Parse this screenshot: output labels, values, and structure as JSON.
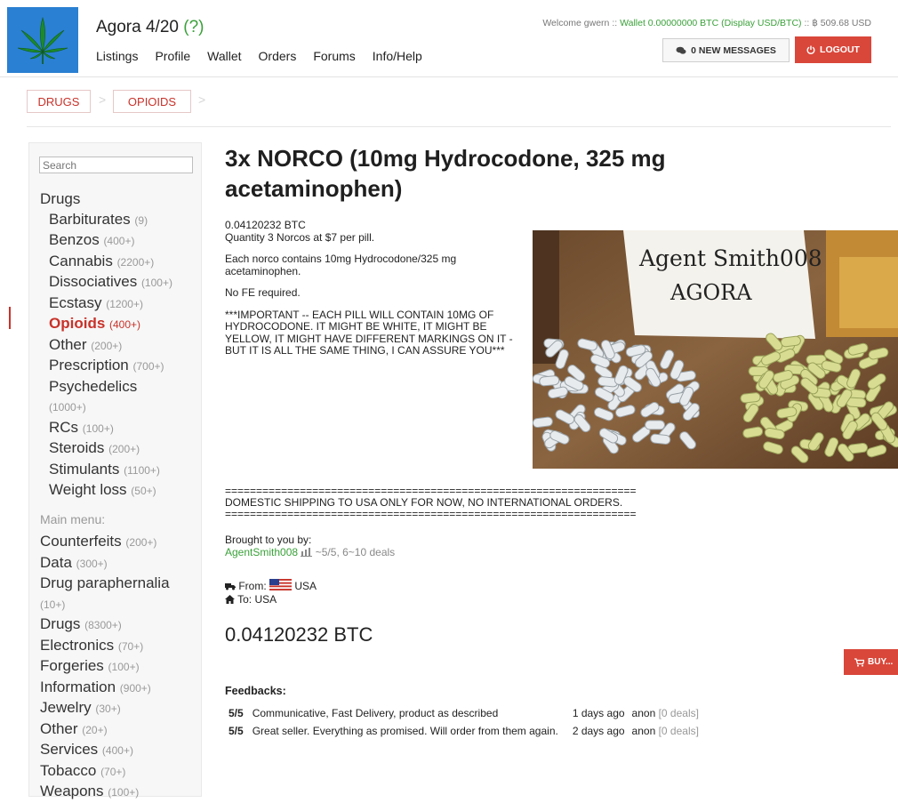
{
  "header": {
    "site_name": "Agora 4/20",
    "help_mark": "(?)",
    "nav": [
      "Listings",
      "Profile",
      "Wallet",
      "Orders",
      "Forums",
      "Info/Help"
    ],
    "welcome_prefix": "Welcome gwern :: ",
    "wallet_text": "Wallet 0.00000000 BTC",
    "display_text": "(Display USD/BTC)",
    "rate_text": " :: ฿ 509.68 USD",
    "messages_label": "0 NEW MESSAGES",
    "logout_label": "LOGOUT"
  },
  "breadcrumb": [
    "DRUGS",
    "OPIOIDS"
  ],
  "sidebar": {
    "search_placeholder": "Search",
    "section_label": "Drugs",
    "drug_items": [
      {
        "label": "Barbiturates",
        "count": "(9)"
      },
      {
        "label": "Benzos",
        "count": "(400+)"
      },
      {
        "label": "Cannabis",
        "count": "(2200+)"
      },
      {
        "label": "Dissociatives",
        "count": "(100+)"
      },
      {
        "label": "Ecstasy",
        "count": "(1200+)"
      },
      {
        "label": "Opioids",
        "count": "(400+)"
      },
      {
        "label": "Other",
        "count": "(200+)"
      },
      {
        "label": "Prescription",
        "count": "(700+)"
      },
      {
        "label": "Psychedelics",
        "count": "(1000+)"
      },
      {
        "label": "RCs",
        "count": "(100+)"
      },
      {
        "label": "Steroids",
        "count": "(200+)"
      },
      {
        "label": "Stimulants",
        "count": "(1100+)"
      },
      {
        "label": "Weight loss",
        "count": "(50+)"
      }
    ],
    "main_menu_label": "Main menu:",
    "main_items": [
      {
        "label": "Counterfeits",
        "count": "(200+)"
      },
      {
        "label": "Data",
        "count": "(300+)"
      },
      {
        "label": "Drug paraphernalia",
        "count": "(10+)"
      },
      {
        "label": "Drugs",
        "count": "(8300+)"
      },
      {
        "label": "Electronics",
        "count": "(70+)"
      },
      {
        "label": "Forgeries",
        "count": "(100+)"
      },
      {
        "label": "Information",
        "count": "(900+)"
      },
      {
        "label": "Jewelry",
        "count": "(30+)"
      },
      {
        "label": "Other",
        "count": "(20+)"
      },
      {
        "label": "Services",
        "count": "(400+)"
      },
      {
        "label": "Tobacco",
        "count": "(70+)"
      },
      {
        "label": "Weapons",
        "count": "(100+)"
      }
    ]
  },
  "listing": {
    "title": "3x NORCO (10mg Hydrocodone, 325 mg acetaminophen)",
    "price_line": "0.04120232 BTC",
    "quantity_line": "Quantity 3 Norcos at $7 per pill.",
    "desc_1": "Each norco contains 10mg Hydrocodone/325 mg acetaminophen.",
    "desc_2": "No FE required.",
    "desc_3": "***IMPORTANT -- EACH PILL WILL CONTAIN 10MG OF HYDROCODONE. IT MIGHT BE WHITE, IT MIGHT BE YELLOW, IT MIGHT HAVE DIFFERENT MARKINGS ON IT - BUT IT IS ALL THE SAME THING, I CAN ASSURE YOU***",
    "photo_note_1": "Agent Smith008",
    "photo_note_2": "AGORA",
    "separator": "==================================================================",
    "shipping_note": "DOMESTIC SHIPPING TO USA ONLY FOR NOW, NO INTERNATIONAL ORDERS.",
    "brought_label": "Brought to you by:",
    "seller": "AgentSmith008",
    "seller_stats": "~5/5, 6~10 deals",
    "from_label": "From:",
    "from_country": "USA",
    "to_label": "To: USA",
    "price": "0.04120232 BTC",
    "buy_label": "BUY..."
  },
  "feedbacks": {
    "title": "Feedbacks:",
    "rows": [
      {
        "rating": "5/5",
        "comment": "Communicative, Fast Delivery, product as described",
        "time": "1 days ago",
        "user": "anon",
        "deals": "[0 deals]"
      },
      {
        "rating": "5/5",
        "comment": "Great seller. Everything as promised. Will order from them again.",
        "time": "2 days ago",
        "user": "anon",
        "deals": "[0 deals]"
      }
    ]
  },
  "colors": {
    "accent_red": "#d9473a",
    "link_green": "#3aa13a",
    "logo_blue": "#2a80d2"
  }
}
